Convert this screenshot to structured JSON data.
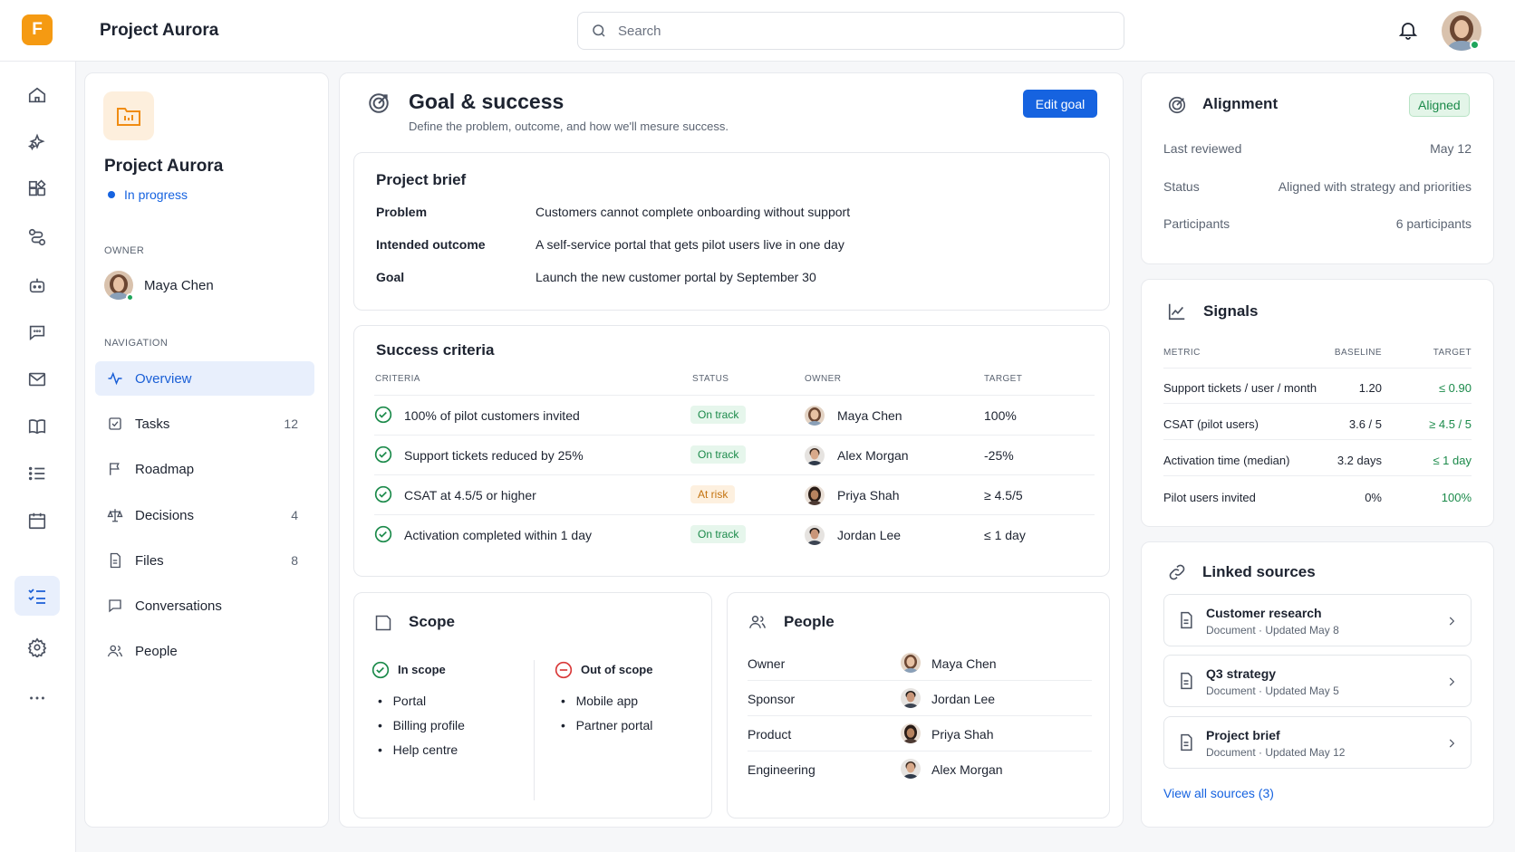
{
  "app": {
    "logo_letter": "F",
    "title": "Project Aurora",
    "accent": "#1663e0",
    "logo_color": "#f59a12"
  },
  "search": {
    "placeholder": "Search"
  },
  "project": {
    "name": "Project Aurora",
    "status": "In progress",
    "owner_label": "OWNER",
    "owner_name": "Maya Chen",
    "nav_label": "NAVIGATION"
  },
  "nav": [
    {
      "label": "Overview",
      "count": "",
      "icon": "activity-icon",
      "active": true
    },
    {
      "label": "Tasks",
      "count": "12",
      "icon": "checkbox-icon"
    },
    {
      "label": "Roadmap",
      "count": "",
      "icon": "flag-icon"
    },
    {
      "label": "Decisions",
      "count": "4",
      "icon": "scale-icon"
    },
    {
      "label": "Files",
      "count": "8",
      "icon": "file-icon"
    },
    {
      "label": "Conversations",
      "count": "",
      "icon": "chat-icon"
    },
    {
      "label": "People",
      "count": "",
      "icon": "people-icon"
    }
  ],
  "goal": {
    "title": "Goal & success",
    "subtitle": "Define the problem, outcome, and how we'll mesure success.",
    "edit_label": "Edit goal"
  },
  "brief": {
    "title": "Project brief",
    "rows": [
      {
        "label": "Problem",
        "value": "Customers cannot complete onboarding without support"
      },
      {
        "label": "Intended outcome",
        "value": "A self-service portal that gets pilot users live in one day"
      },
      {
        "label": "Goal",
        "value": "Launch the new customer portal by September 30"
      }
    ]
  },
  "criteria": {
    "title": "Success criteria",
    "headers": {
      "criteria": "CRITERIA",
      "status": "STATUS",
      "owner": "OWNER",
      "target": "TARGET"
    },
    "rows": [
      {
        "criteria": "100% of pilot customers invited",
        "status": "On track",
        "owner": "Maya Chen",
        "target": "100%"
      },
      {
        "criteria": "Support tickets reduced by 25%",
        "status": "On track",
        "owner": "Alex Morgan",
        "target": "-25%"
      },
      {
        "criteria": "CSAT at 4.5/5 or higher",
        "status": "At risk",
        "owner": "Priya Shah",
        "target": "≥ 4.5/5"
      },
      {
        "criteria": "Activation completed within 1 day",
        "status": "On track",
        "owner": "Jordan Lee",
        "target": "≤ 1 day"
      }
    ]
  },
  "scope": {
    "title": "Scope",
    "in_label": "In scope",
    "in_items": [
      "Portal",
      "Billing profile",
      "Help centre"
    ],
    "out_label": "Out of scope",
    "out_items": [
      "Mobile app",
      "Partner portal"
    ]
  },
  "people": {
    "title": "People",
    "rows": [
      {
        "role": "Owner",
        "name": "Maya Chen"
      },
      {
        "role": "Sponsor",
        "name": "Jordan Lee"
      },
      {
        "role": "Product",
        "name": "Priya Shah"
      },
      {
        "role": "Engineering",
        "name": "Alex Morgan"
      }
    ]
  },
  "alignment": {
    "title": "Alignment",
    "badge": "Aligned",
    "rows": [
      {
        "label": "Last reviewed",
        "value": "May 12"
      },
      {
        "label": "Status",
        "value": "Aligned with strategy and priorities"
      },
      {
        "label": "Participants",
        "value": "6 participants"
      }
    ]
  },
  "signals": {
    "title": "Signals",
    "headers": {
      "metric": "METRIC",
      "baseline": "BASELINE",
      "target": "TARGET"
    },
    "rows": [
      {
        "metric": "Support tickets / user / month",
        "baseline": "1.20",
        "target": "≤ 0.90"
      },
      {
        "metric": "CSAT (pilot users)",
        "baseline": "3.6 / 5",
        "target": "≥ 4.5 / 5"
      },
      {
        "metric": "Activation time (median)",
        "baseline": "3.2 days",
        "target": "≤ 1 day"
      },
      {
        "metric": "Pilot users invited",
        "baseline": "0%",
        "target": "100%"
      }
    ]
  },
  "sources": {
    "title": "Linked sources",
    "items": [
      {
        "title": "Customer research",
        "meta": "Document · Updated May 8"
      },
      {
        "title": "Q3 strategy",
        "meta": "Document · Updated May 5"
      },
      {
        "title": "Project brief",
        "meta": "Document · Updated May 12"
      }
    ],
    "view_all": "View all sources (3)"
  },
  "colors": {
    "on_track": "#1b8a4a",
    "at_risk": "#c4730f",
    "target_green": "#1b8a4a"
  }
}
